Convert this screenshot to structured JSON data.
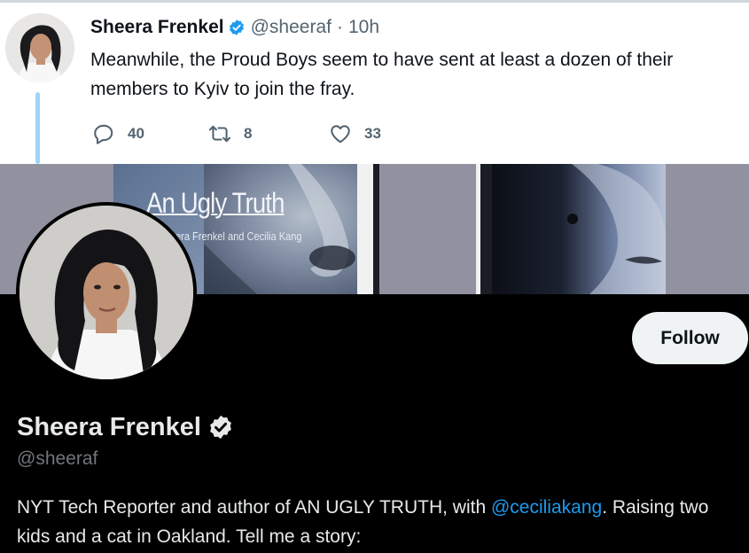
{
  "tweet": {
    "author_name": "Sheera Frenkel",
    "author_handle": "@sheeraf",
    "separator": "·",
    "timestamp": "10h",
    "text": "Meanwhile, the Proud Boys seem to have sent at least a dozen of their members to Kyiv to join the fray.",
    "replies": "40",
    "retweets": "8",
    "likes": "33"
  },
  "banner": {
    "book_title": "An Ugly Truth",
    "book_authors": "era Frenkel and Cecilia Kang"
  },
  "profile": {
    "name": "Sheera Frenkel",
    "handle": "@sheeraf",
    "follow_label": "Follow",
    "bio_part1": "NYT Tech Reporter and author of AN UGLY TRUTH, with ",
    "bio_mention": "@ceciliakang",
    "bio_part2": ". Raising two kids and a cat in Oakland. Tell me a story:"
  },
  "icons": {
    "verified": "verified-badge-icon",
    "reply": "reply-icon",
    "retweet": "retweet-icon",
    "like": "heart-icon"
  },
  "colors": {
    "accent": "#1d9bf0",
    "thread_line": "#9fd3f7",
    "dark_bg": "#000000",
    "muted_text": "#536471"
  }
}
